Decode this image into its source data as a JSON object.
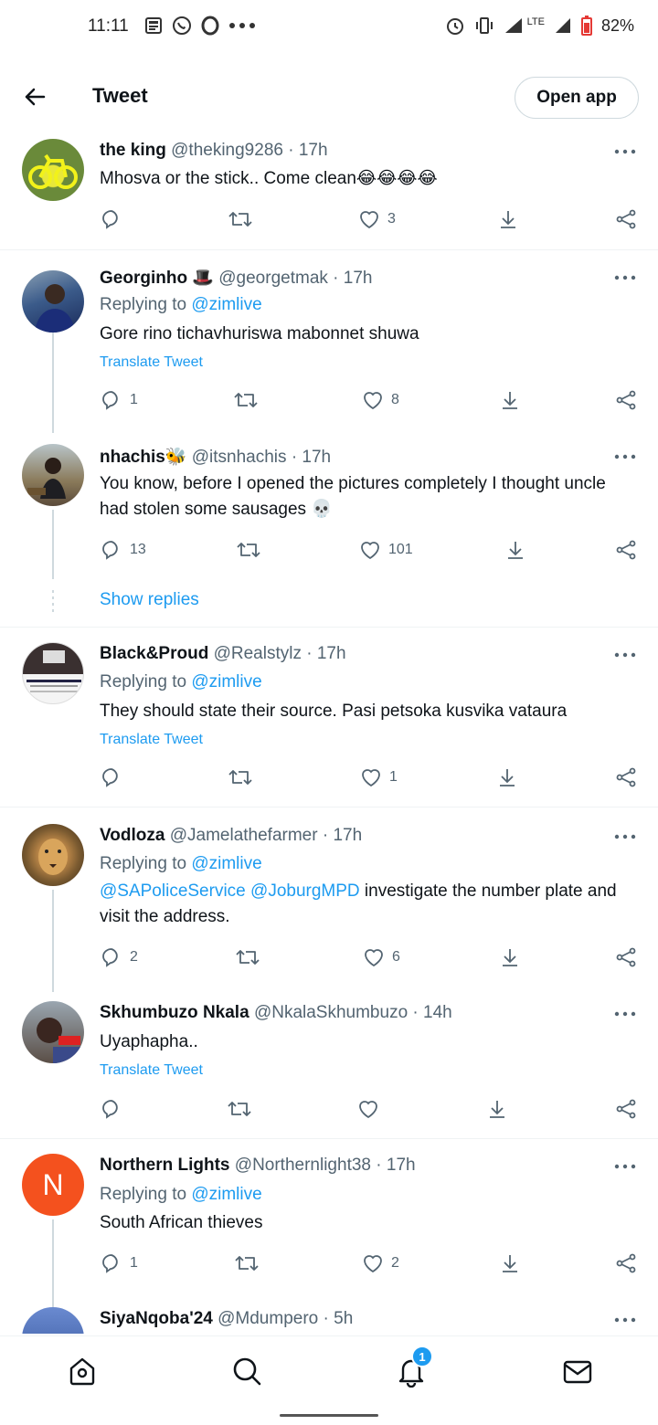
{
  "status_bar": {
    "time": "11:11",
    "network": "LTE",
    "battery": "82%"
  },
  "header": {
    "title": "Tweet",
    "open_app_label": "Open app"
  },
  "tweets": [
    {
      "name": "the king",
      "handle": "@theking9286",
      "time": "· 17h",
      "text": "Mhosva or the stick.. Come clean😂😂😂😂",
      "reply_count": "",
      "like_count": "3"
    },
    {
      "name": "Georginho 🎩",
      "handle": "@georgetmak",
      "time": "· 17h",
      "replying_prefix": "Replying to ",
      "replying_to": "@zimlive",
      "text": "Gore rino tichavhuriswa mabonnet shuwa",
      "translate": "Translate Tweet",
      "reply_count": "1",
      "like_count": "8"
    },
    {
      "name": "nhachis🐝",
      "handle": "@itsnhachis",
      "time": "· 17h",
      "text": "You know, before I opened the pictures completely I thought uncle had stolen some sausages 💀",
      "reply_count": "13",
      "like_count": "101"
    },
    {
      "name": "Black&Proud",
      "handle": "@Realstylz",
      "time": "· 17h",
      "replying_prefix": "Replying to ",
      "replying_to": "@zimlive",
      "text": "They should state their source. Pasi  petsoka kusvika vataura",
      "translate": "Translate Tweet",
      "reply_count": "",
      "like_count": "1"
    },
    {
      "name": "Vodloza",
      "handle": "@Jamelathefarmer",
      "time": "· 17h",
      "replying_prefix": "Replying to ",
      "replying_to": "@zimlive",
      "mention1": "@SAPoliceService",
      "mention2": "@JoburgMPD",
      "text_rest": " investigate the number plate and visit the address.",
      "reply_count": "2",
      "like_count": "6"
    },
    {
      "name": "Skhumbuzo Nkala",
      "handle": "@NkalaSkhumbuzo",
      "time": "· 14h",
      "text": "Uyaphapha..",
      "translate": "Translate Tweet",
      "reply_count": "",
      "like_count": ""
    },
    {
      "name": "Northern Lights",
      "handle": "@Northernlight38",
      "time": "· 17h",
      "avatar_letter": "N",
      "replying_prefix": "Replying to ",
      "replying_to": "@zimlive",
      "text": "South African thieves",
      "reply_count": "1",
      "like_count": "2"
    },
    {
      "name": "SiyaNqoba'24",
      "handle": "@Mdumpero",
      "time": "· 5h"
    }
  ],
  "show_replies_label": "Show replies",
  "bottom_nav": {
    "notifications_badge": "1"
  },
  "colors": {
    "accent": "#1d9bf0",
    "text": "#0f1419",
    "secondary": "#536471",
    "avatar_n": "#f4511e"
  }
}
